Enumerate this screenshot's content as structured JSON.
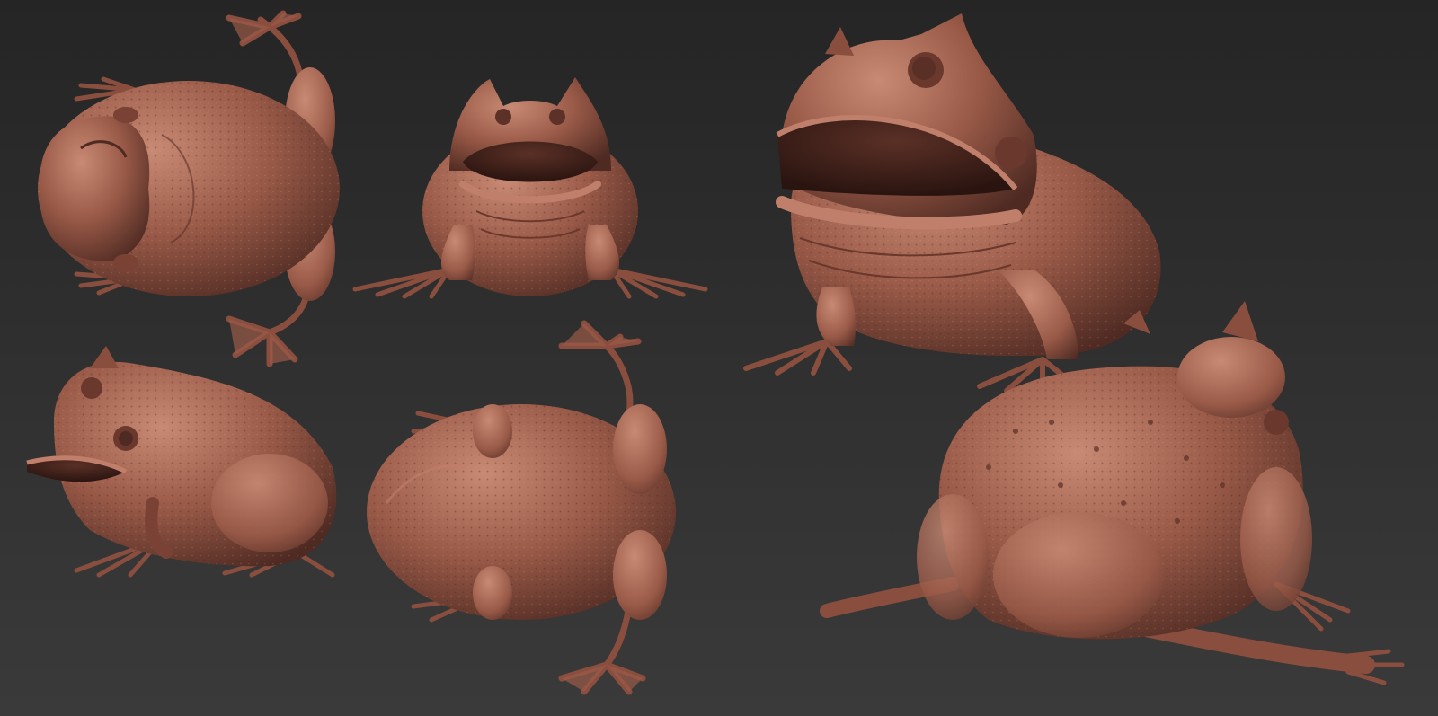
{
  "image": {
    "subject": "horned-frog-sculpt-turnaround",
    "views": [
      {
        "view": "top"
      },
      {
        "view": "front"
      },
      {
        "view": "side"
      },
      {
        "view": "bottom"
      },
      {
        "view": "three-quarter-front"
      },
      {
        "view": "three-quarter-back"
      }
    ]
  },
  "colors": {
    "background_top": "#252525",
    "background_bottom": "#3a3a3a",
    "clay_base": "#9a5a48",
    "clay_highlight": "#c88a74",
    "clay_shadow": "#4e2a22",
    "clay_deep": "#3a1e18"
  }
}
